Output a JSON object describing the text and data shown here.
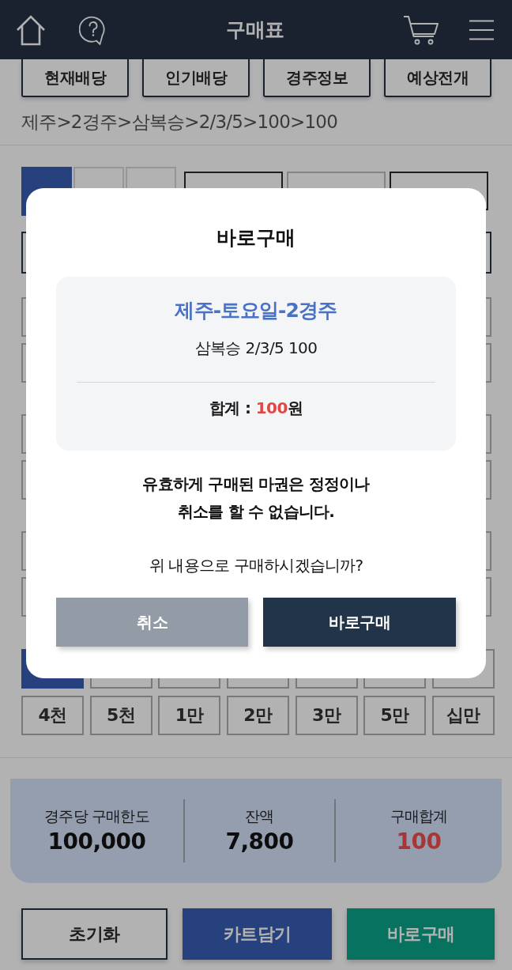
{
  "header": {
    "title": "구매표"
  },
  "quick_buttons": [
    "현재배당",
    "인기배당",
    "경주정보",
    "예상전개"
  ],
  "breadcrumb": "제주>2경주>삼복승>2/3/5>100>100",
  "number_tabs": [
    {
      "selected": true
    },
    {
      "selected": false
    },
    {
      "selected": false
    }
  ],
  "select_buttons": [
    {
      "disabled": false
    },
    {
      "disabled": true
    },
    {
      "disabled": false
    }
  ],
  "amount_rows": [
    [
      {
        "selected": true
      },
      {
        "selected": false
      },
      {
        "selected": false
      },
      {
        "selected": false
      },
      {
        "selected": false
      },
      {
        "selected": false
      },
      {
        "selected": false
      }
    ],
    [
      {
        "label": "4천",
        "selected": false
      },
      {
        "label": "5천",
        "selected": false
      },
      {
        "label": "1만",
        "selected": false
      },
      {
        "label": "2만",
        "selected": false
      },
      {
        "label": "3만",
        "selected": false
      },
      {
        "label": "5만",
        "selected": false
      },
      {
        "label": "십만",
        "selected": false
      }
    ]
  ],
  "summary": [
    {
      "label": "경주당 구매한도",
      "value": "100,000",
      "kind": "plain"
    },
    {
      "label": "잔액",
      "value": "7,800",
      "kind": "plain"
    },
    {
      "label": "구매합계",
      "value": "100",
      "kind": "total"
    }
  ],
  "actions": [
    {
      "label": "초기화",
      "kind": "outline"
    },
    {
      "label": "카트담기",
      "kind": "cart"
    },
    {
      "label": "바로구매",
      "kind": "buy"
    }
  ],
  "dialog": {
    "title": "바로구매",
    "race": "제주-토요일-2경주",
    "bet": "삼복승 2/3/5 100",
    "total_label": "합계 :",
    "total_amount": "100",
    "total_unit": "원",
    "warning": [
      "유효하게 구매된 마권은 정정이나",
      "취소를 할 수 없습니다."
    ],
    "question": "위 내용으로 구매하시겠습니까?",
    "buttons": [
      {
        "label": "취소",
        "kind": "cancel"
      },
      {
        "label": "바로구매",
        "kind": "confirm"
      }
    ]
  }
}
